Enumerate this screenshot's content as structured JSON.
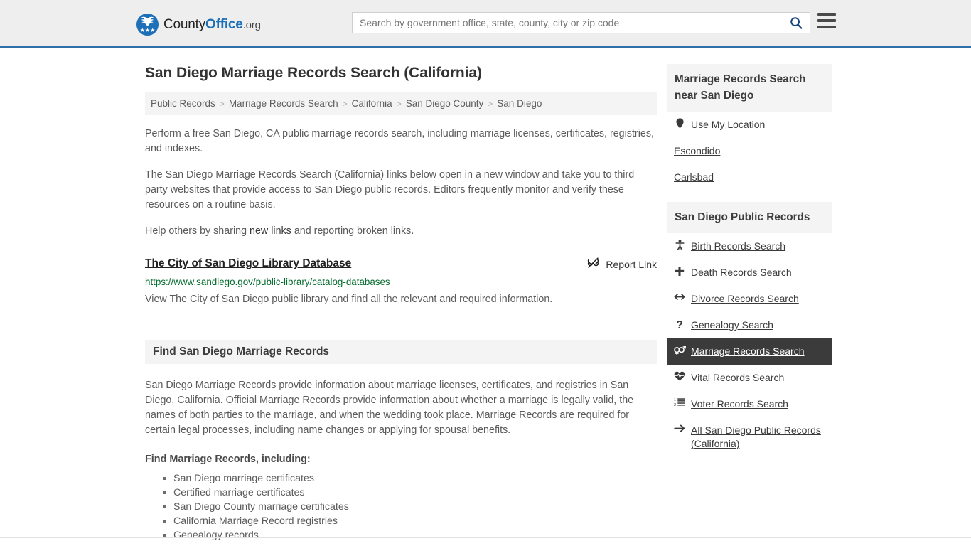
{
  "header": {
    "brand": {
      "part1": "County",
      "part2": "Office",
      "part3": ".org",
      "logo_icon": "eagle-shield-logo",
      "stars": "★★★"
    },
    "search": {
      "placeholder": "Search by government office, state, county, city or zip code",
      "value": "",
      "button_icon": "search-icon"
    },
    "menu_icon": "hamburger-menu-icon",
    "accent_color": "#2f70a8",
    "background_color": "#eeeeee"
  },
  "main": {
    "title": "San Diego Marriage Records Search (California)",
    "breadcrumb": [
      {
        "label": "Public Records"
      },
      {
        "label": "Marriage Records Search"
      },
      {
        "label": "California"
      },
      {
        "label": "San Diego County"
      },
      {
        "label": "San Diego"
      }
    ],
    "breadcrumb_separator": ">",
    "intro_paragraph": "Perform a free San Diego, CA public marriage records search, including marriage licenses, certificates, registries, and indexes.",
    "secondary_paragraph": "The San Diego Marriage Records Search (California) links below open in a new window and take you to third party websites that provide access to San Diego public records. Editors frequently monitor and verify these resources on a routine basis.",
    "help_paragraph": {
      "before": "Help others by sharing ",
      "link": "new links",
      "after": " and reporting broken links."
    },
    "result": {
      "title": "The City of San Diego Library Database",
      "url": "https://www.sandiego.gov/public-library/catalog-databases",
      "description": "View The City of San Diego public library and find all the relevant and required information.",
      "report_label": "Report Link",
      "report_icon": "broken-link-icon",
      "url_color": "#046c2e"
    },
    "section": {
      "heading": "Find San Diego Marriage Records",
      "paragraph": "San Diego Marriage Records provide information about marriage licenses, certificates, and registries in San Diego, California. Official Marriage Records provide information about whether a marriage is legally valid, the names of both parties to the marriage, and when the wedding took place. Marriage Records are required for certain legal processes, including name changes or applying for spousal benefits.",
      "subheading": "Find Marriage Records, including:",
      "bullets": [
        "San Diego marriage certificates",
        "Certified marriage certificates",
        "San Diego County marriage certificates",
        "California Marriage Record registries",
        "Genealogy records"
      ]
    }
  },
  "sidebar": {
    "nearby_panel": {
      "title": "Marriage Records Search near San Diego",
      "items": [
        {
          "label": "Use My Location",
          "icon": "map-pin-icon",
          "has_icon": true
        },
        {
          "label": "Escondido",
          "icon": "",
          "has_icon": false
        },
        {
          "label": "Carlsbad",
          "icon": "",
          "has_icon": false
        }
      ]
    },
    "records_panel": {
      "title": "San Diego Public Records",
      "active_background": "#3b3b3b",
      "items": [
        {
          "label": "Birth Records Search",
          "icon": "baby-icon",
          "active": false
        },
        {
          "label": "Death Records Search",
          "icon": "cross-icon",
          "active": false
        },
        {
          "label": "Divorce Records Search",
          "icon": "arrows-left-right-icon",
          "active": false
        },
        {
          "label": "Genealogy Search",
          "icon": "question-mark-icon",
          "active": false
        },
        {
          "label": "Marriage Records Search",
          "icon": "venus-mars-icon",
          "active": true
        },
        {
          "label": "Vital Records Search",
          "icon": "heart-pulse-icon",
          "active": false
        },
        {
          "label": "Voter Records Search",
          "icon": "ordered-list-icon",
          "active": false
        },
        {
          "label": "All San Diego Public Records (California)",
          "icon": "arrow-right-icon",
          "active": false
        }
      ]
    }
  }
}
